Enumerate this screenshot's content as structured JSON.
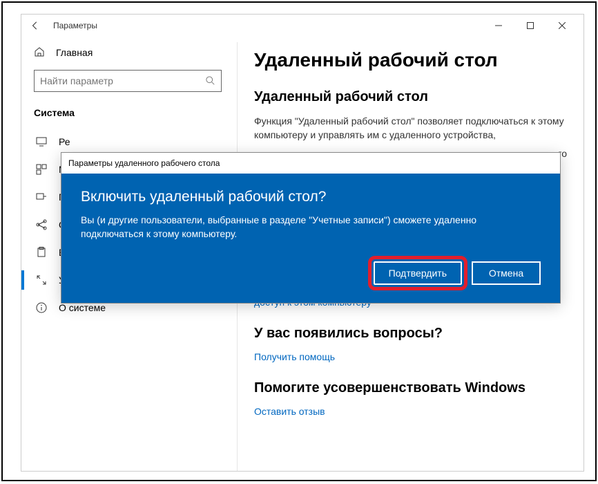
{
  "window": {
    "title": "Параметры"
  },
  "sidebar": {
    "home": "Главная",
    "search_placeholder": "Найти параметр",
    "section": "Система",
    "items": [
      {
        "label": "Ре",
        "iconkey": "display"
      },
      {
        "label": "М",
        "iconkey": "multitask"
      },
      {
        "label": "П",
        "iconkey": "project"
      },
      {
        "label": "О",
        "iconkey": "share"
      },
      {
        "label": "Буфер обмена",
        "iconkey": "clipboard"
      },
      {
        "label": "Удаленный рабочий стол",
        "iconkey": "remote"
      },
      {
        "label": "О системе",
        "iconkey": "info"
      }
    ]
  },
  "content": {
    "page_title": "Удаленный рабочий стол",
    "sub1": "Удаленный рабочий стол",
    "desc1": "Функция \"Удаленный рабочий стол\" позволяет подключаться к этому компьютеру и управлять им с удаленного устройства,",
    "desc1b": "го",
    "link1": "доступ к этом компьютеру",
    "sub2": "У вас появились вопросы?",
    "link2": "Получить помощь",
    "sub3": "Помогите усовершенствовать Windows",
    "link3": "Оставить отзыв"
  },
  "dialog": {
    "title": "Параметры удаленного рабочего стола",
    "heading": "Включить удаленный рабочий стол?",
    "text": "Вы (и другие пользователи, выбранные в разделе \"Учетные записи\") сможете удаленно подключаться к этому компьютеру.",
    "confirm": "Подтвердить",
    "cancel": "Отмена"
  }
}
